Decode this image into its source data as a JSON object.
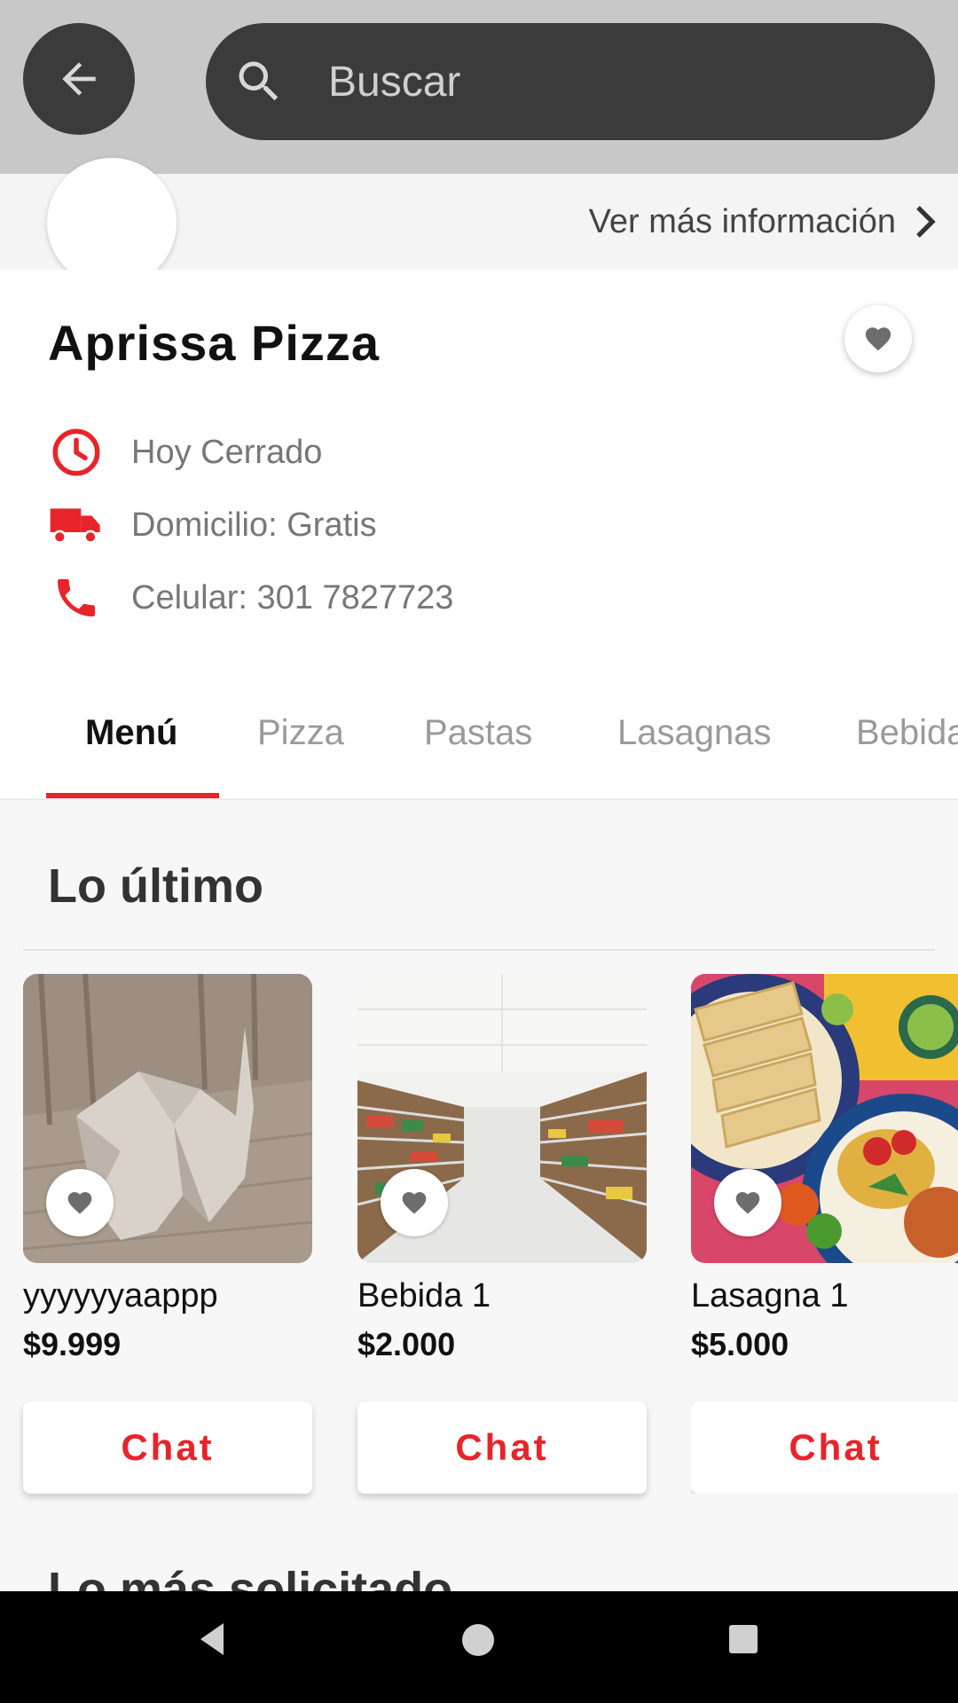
{
  "search": {
    "placeholder": "Buscar"
  },
  "header": {
    "more_info": "Ver más información"
  },
  "store": {
    "name": "Aprissa Pizza",
    "status": "Hoy Cerrado",
    "delivery": "Domicilio: Gratis",
    "phone": "Celular: 301 7827723"
  },
  "tabs": [
    "Menú",
    "Pizza",
    "Pastas",
    "Lasagnas",
    "Bebida"
  ],
  "sections": {
    "latest": "Lo último",
    "most_requested": "Lo más solicitado"
  },
  "products": [
    {
      "name": "yyyyyyaappp",
      "price": "$9.999",
      "chat": "Chat",
      "image": "low-poly-cat-render"
    },
    {
      "name": "Bebida 1",
      "price": "$2.000",
      "chat": "Chat",
      "image": "supermarket-aisle"
    },
    {
      "name": "Lasagna 1",
      "price": "$5.000",
      "chat": "Chat",
      "image": "mexican-food-platter"
    }
  ],
  "colors": {
    "accent": "#e8242b",
    "topbar": "#c8c8c8",
    "pill": "#3b3b3b"
  }
}
